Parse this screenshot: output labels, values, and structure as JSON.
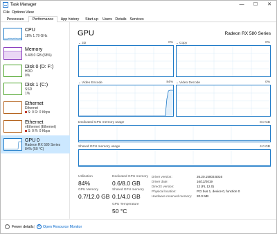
{
  "window": {
    "title": "Task Manager",
    "minimize_glyph": "—",
    "maximize_glyph": "☐",
    "close_glyph": "✕"
  },
  "menu": [
    "File",
    "Options",
    "View"
  ],
  "tabs": [
    "Processes",
    "Performance",
    "App history",
    "Start-up",
    "Users",
    "Details",
    "Services"
  ],
  "active_tab": "Performance",
  "colors": {
    "cpu": "#1e7ac7",
    "memory": "#8b3dbf",
    "disk": "#4aa327",
    "ethernet": "#b5641f",
    "gpu": "#1e7ac7",
    "selected": "#cce8ff",
    "link": "#0066cc"
  },
  "sidebar": {
    "items": [
      {
        "name": "CPU",
        "line1": "18% 1.79 GHz",
        "line2": ""
      },
      {
        "name": "Memory",
        "line1": "5.4/8.0 GB (68%)",
        "line2": ""
      },
      {
        "name": "Disk 0 (D: F:)",
        "line1": "HDD",
        "line2": "0%"
      },
      {
        "name": "Disk 1 (C:)",
        "line1": "SSD",
        "line2": "1%"
      },
      {
        "name": "Ethernet",
        "line1": "Ethernet",
        "line2": "S: 0 R: 0 Kbps"
      },
      {
        "name": "Ethernet",
        "line1": "vEthernet (Ethernet)",
        "line2": "S: 0 R: 0 Kbps"
      },
      {
        "name": "GPU 0",
        "line1": "Radeon RX 580 Series",
        "line2": "84% (50 °C)"
      }
    ]
  },
  "main": {
    "title": "GPU",
    "model": "Radeon RX 580 Series",
    "graphs": {
      "g3d": {
        "label": "3D",
        "pct": "0%"
      },
      "copy": {
        "label": "Copy",
        "pct": "0%"
      },
      "encode": {
        "label": "Video Encode",
        "pct": "84%"
      },
      "decode": {
        "label": "Video Decode",
        "pct": "0%"
      }
    },
    "dedicated_label": "Dedicated GPU memory usage",
    "dedicated_max": "8.0 GB",
    "shared_label": "Shared GPU memory usage",
    "shared_max": "4.0 GB",
    "encode_usage": [
      0,
      0,
      0,
      0,
      0,
      0,
      0,
      0,
      0,
      0,
      0,
      0,
      0,
      0,
      0,
      0,
      0,
      0,
      0,
      0,
      0,
      0,
      0,
      0,
      0,
      0,
      0,
      0,
      0,
      0,
      0,
      0,
      0,
      0,
      0,
      0,
      0,
      0,
      0,
      0,
      0,
      0,
      0,
      0,
      0,
      0,
      0,
      0,
      0,
      0,
      0,
      0,
      0,
      0,
      0,
      0,
      55,
      82,
      84,
      84,
      84
    ],
    "dedicated_usage": 0.6,
    "shared_usage": 0.1
  },
  "stats": {
    "utilization_label": "Utilization",
    "utilization": "84%",
    "dedicated_label": "Dedicated GPU memory",
    "dedicated": "0.6/8.0 GB",
    "gpu_memory_label": "GPU Memory",
    "gpu_memory": "0.7/12.0 GB",
    "shared_label": "Shared GPU memory",
    "shared": "0.1/4.0 GB",
    "temp_label": "GPU Temperature",
    "temp": "50 °C"
  },
  "info": [
    {
      "label": "Driver version:",
      "value": "26.20.15003.5016"
    },
    {
      "label": "Driver date:",
      "value": "16/12/2019"
    },
    {
      "label": "DirectX version:",
      "value": "12 (FL 12.0)"
    },
    {
      "label": "Physical location:",
      "value": "PCI bus 1, device 0, function 0"
    },
    {
      "label": "Hardware reserved memory:",
      "value": "20.0 MB"
    }
  ],
  "footer": {
    "fewer_details": "Fewer details",
    "separator": "|",
    "open_monitor": "Open Resource Monitor"
  }
}
